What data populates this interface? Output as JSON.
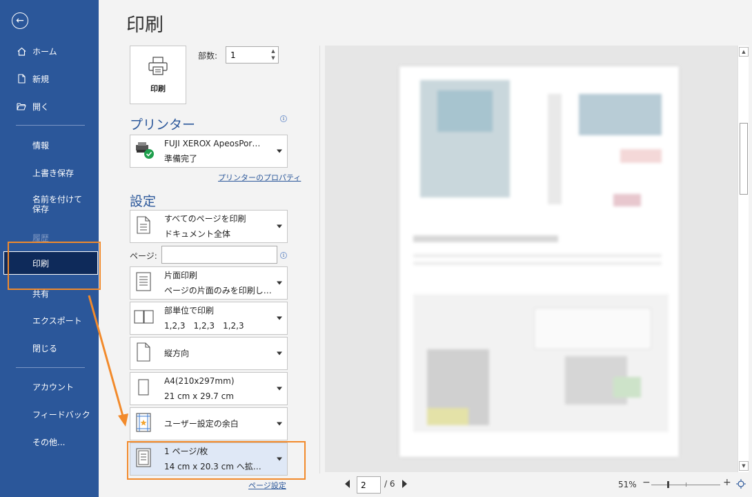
{
  "sidebar": {
    "items": [
      {
        "label": "ホーム",
        "icon": "home-icon"
      },
      {
        "label": "新規",
        "icon": "new-doc-icon"
      },
      {
        "label": "開く",
        "icon": "open-folder-icon"
      },
      {
        "label": "情報"
      },
      {
        "label": "上書き保存"
      },
      {
        "label": "名前を付けて保存"
      },
      {
        "label": "履歴"
      },
      {
        "label": "印刷"
      },
      {
        "label": "共有"
      },
      {
        "label": "エクスポート"
      },
      {
        "label": "閉じる"
      },
      {
        "label": "アカウント"
      },
      {
        "label": "フィードバック"
      },
      {
        "label": "その他..."
      }
    ]
  },
  "main": {
    "title": "印刷",
    "print_button_label": "印刷",
    "copies_label": "部数:",
    "copies_value": "1",
    "printer_header": "プリンター",
    "printer_name": "FUJI XEROX ApeosPor…",
    "printer_status": "準備完了",
    "printer_props_link": "プリンターのプロパティ",
    "settings_header": "設定",
    "pages_label": "ページ:",
    "pages_value": "",
    "settings": [
      {
        "line1": "すべてのページを印刷",
        "line2": "ドキュメント全体"
      },
      {
        "line1": "片面印刷",
        "line2": "ページの片面のみを印刷し…"
      },
      {
        "line1": "部単位で印刷",
        "line2": "1,2,3　1,2,3　1,2,3"
      },
      {
        "line1": "縦方向",
        "line2": ""
      },
      {
        "line1": "A4(210x297mm)",
        "line2": "21 cm x 29.7 cm"
      },
      {
        "line1": "ユーザー設定の余白",
        "line2": ""
      },
      {
        "line1": "1 ページ/枚",
        "line2": "14 cm x 20.3 cm へ拡…"
      }
    ],
    "page_setup_link": "ページ設定"
  },
  "preview": {
    "current_page": "2",
    "total_pages": "/ 6",
    "zoom": "51%",
    "zoom_fraction": 0.51
  },
  "colors": {
    "sidebar": "#2b579a",
    "selected": "#0e2a5a",
    "annotation": "#f28a2b"
  }
}
